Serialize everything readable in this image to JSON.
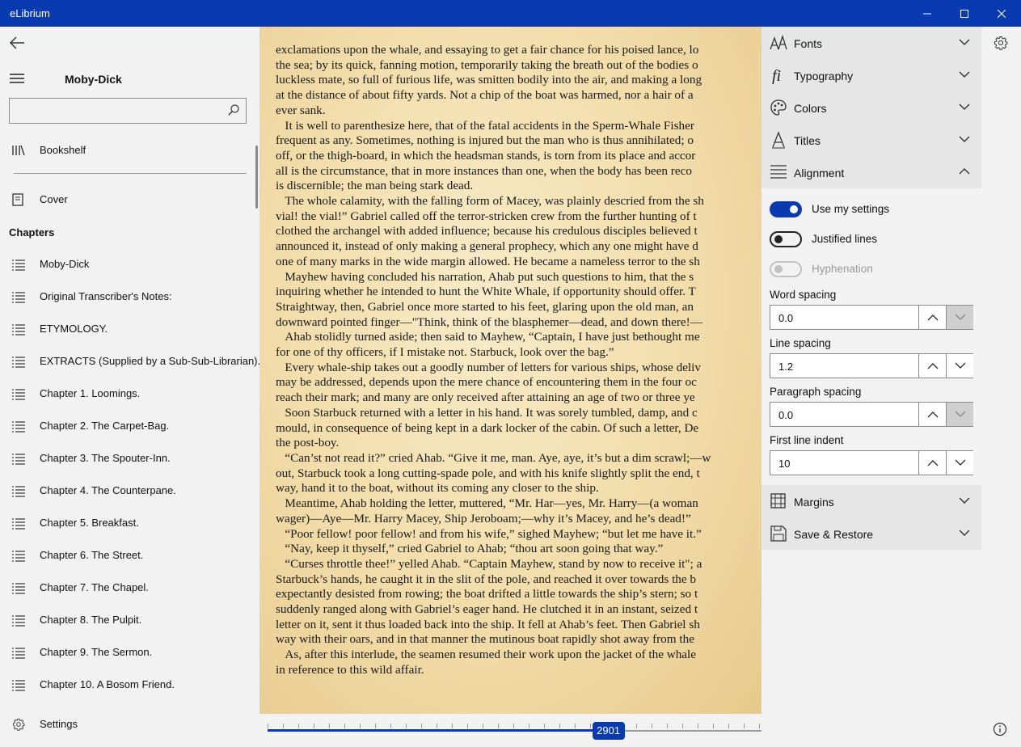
{
  "window": {
    "title": "eLibrium"
  },
  "nav": {
    "book_title": "Moby-Dick",
    "search": {
      "value": "",
      "placeholder": ""
    },
    "bookshelf": "Bookshelf",
    "cover": "Cover",
    "chapters_heading": "Chapters",
    "chapters": [
      "Moby-Dick",
      "Original Transcriber's Notes:",
      "ETYMOLOGY.",
      "EXTRACTS (Supplied by a Sub-Sub-Librarian).",
      "Chapter 1. Loomings.",
      "Chapter 2. The Carpet-Bag.",
      "Chapter 3. The Spouter-Inn.",
      "Chapter 4. The Counterpane.",
      "Chapter 5. Breakfast.",
      "Chapter 6. The Street.",
      "Chapter 7. The Chapel.",
      "Chapter 8. The Pulpit.",
      "Chapter 9. The Sermon.",
      "Chapter 10. A Bosom Friend."
    ],
    "settings": "Settings"
  },
  "reader": {
    "lines": [
      "exclamations upon the whale, and essaying to get a fair chance for his poised lance, lo",
      "the sea; by its quick, fanning motion, temporarily taking the breath out of the bodies o",
      "luckless mate, so full of furious life, was smitten bodily into the air, and making a long",
      "at the distance of about fifty yards. Not a chip of the boat was harmed, nor a hair of a",
      "ever sank.",
      "   It is well to parenthesize here, that of the fatal accidents in the Sperm-Whale Fisher",
      "frequent as any. Sometimes, nothing is injured but the man who is thus annihilated; o",
      "off, or the thigh-board, in which the headsman stands, is torn from its place and accor",
      "all is the circumstance, that in more instances than one, when the body has been reco",
      "is discernible; the man being stark dead.",
      "   The whole calamity, with the falling form of Macey, was plainly descried from the sh",
      "vial! the vial!” Gabriel called off the terror-stricken crew from the further hunting of t",
      "clothed the archangel with added influence; because his credulous disciples believed t",
      "announced it, instead of only making a general prophecy, which any one might have d",
      "one of many marks in the wide margin allowed. He became a nameless terror to the sh",
      "   Mayhew having concluded his narration, Ahab put such questions to him, that the s",
      "inquiring whether he intended to hunt the White Whale, if opportunity should offer. T",
      "Straightway, then, Gabriel once more started to his feet, glaring upon the old man, an",
      "downward pointed finger—\"Think, think of the blasphemer—dead, and down there!—",
      "   Ahab stolidly turned aside; then said to Mayhew, “Captain, I have just bethought me",
      "for one of thy officers, if I mistake not. Starbuck, look over the bag.”",
      "   Every whale-ship takes out a goodly number of letters for various ships, whose deliv",
      "may be addressed, depends upon the mere chance of encountering them in the four oc",
      "reach their mark; and many are only received after attaining an age of two or three ye",
      "   Soon Starbuck returned with a letter in his hand. It was sorely tumbled, damp, and c",
      "mould, in consequence of being kept in a dark locker of the cabin. Of such a letter, De",
      "the post-boy.",
      "   “Can’st not read it?” cried Ahab. “Give it me, man. Aye, aye, it’s but a dim scrawl;—w",
      "out, Starbuck took a long cutting-spade pole, and with his knife slightly split the end, t",
      "way, hand it to the boat, without its coming any closer to the ship.",
      "   Meantime, Ahab holding the letter, muttered, “Mr. Har—yes, Mr. Harry—(a woman",
      "wager)—Aye—Mr. Harry Macey, Ship Jeroboam;—why it’s Macey, and he’s dead!”",
      "   “Poor fellow! poor fellow! and from his wife,” sighed Mayhew; “but let me have it.”",
      "   “Nay, keep it thyself,” cried Gabriel to Ahab; “thou art soon going that way.”",
      "   “Curses throttle thee!” yelled Ahab. “Captain Mayhew, stand by now to receive it\"; a",
      "Starbuck’s hands, he caught it in the slit of the pole, and reached it over towards the b",
      "expectantly desisted from rowing; the boat drifted a little towards the ship’s stern; so t",
      "suddenly ranged along with Gabriel’s eager hand. He clutched it in an instant, seized t",
      "letter on it, sent it thus loaded back into the ship. It fell at Ahab’s feet. Then Gabriel sh",
      "way with their oars, and in that manner the mutinous boat rapidly shot away from the",
      "   As, after this interlude, the seamen resumed their work upon the jacket of the whale",
      "in reference to this wild affair."
    ],
    "position": "2901",
    "progress": 0.69
  },
  "panel": {
    "sections_top": [
      {
        "label": "Fonts",
        "icon": "font-size-icon"
      },
      {
        "label": "Typography",
        "icon": "ligature-fi-icon"
      },
      {
        "label": "Colors",
        "icon": "palette-icon"
      },
      {
        "label": "Titles",
        "icon": "title-a-icon"
      },
      {
        "label": "Alignment",
        "icon": "align-lines-icon"
      }
    ],
    "alignment": {
      "use_my_settings": "Use my settings",
      "justified_lines": "Justified lines",
      "hyphenation": "Hyphenation",
      "word_spacing": {
        "label": "Word spacing",
        "value": "0.0"
      },
      "line_spacing": {
        "label": "Line spacing",
        "value": "1.2"
      },
      "paragraph_spacing": {
        "label": "Paragraph spacing",
        "value": "0.0"
      },
      "first_line_indent": {
        "label": "First line indent",
        "value": "10"
      }
    },
    "sections_bottom": [
      {
        "label": "Margins",
        "icon": "margins-grid-icon"
      },
      {
        "label": "Save & Restore",
        "icon": "floppy-disk-icon"
      }
    ]
  },
  "colors": {
    "accent": "#0a3ab0",
    "panel_header_bg": "#e6e6e6",
    "background": "#f2f2f2"
  }
}
